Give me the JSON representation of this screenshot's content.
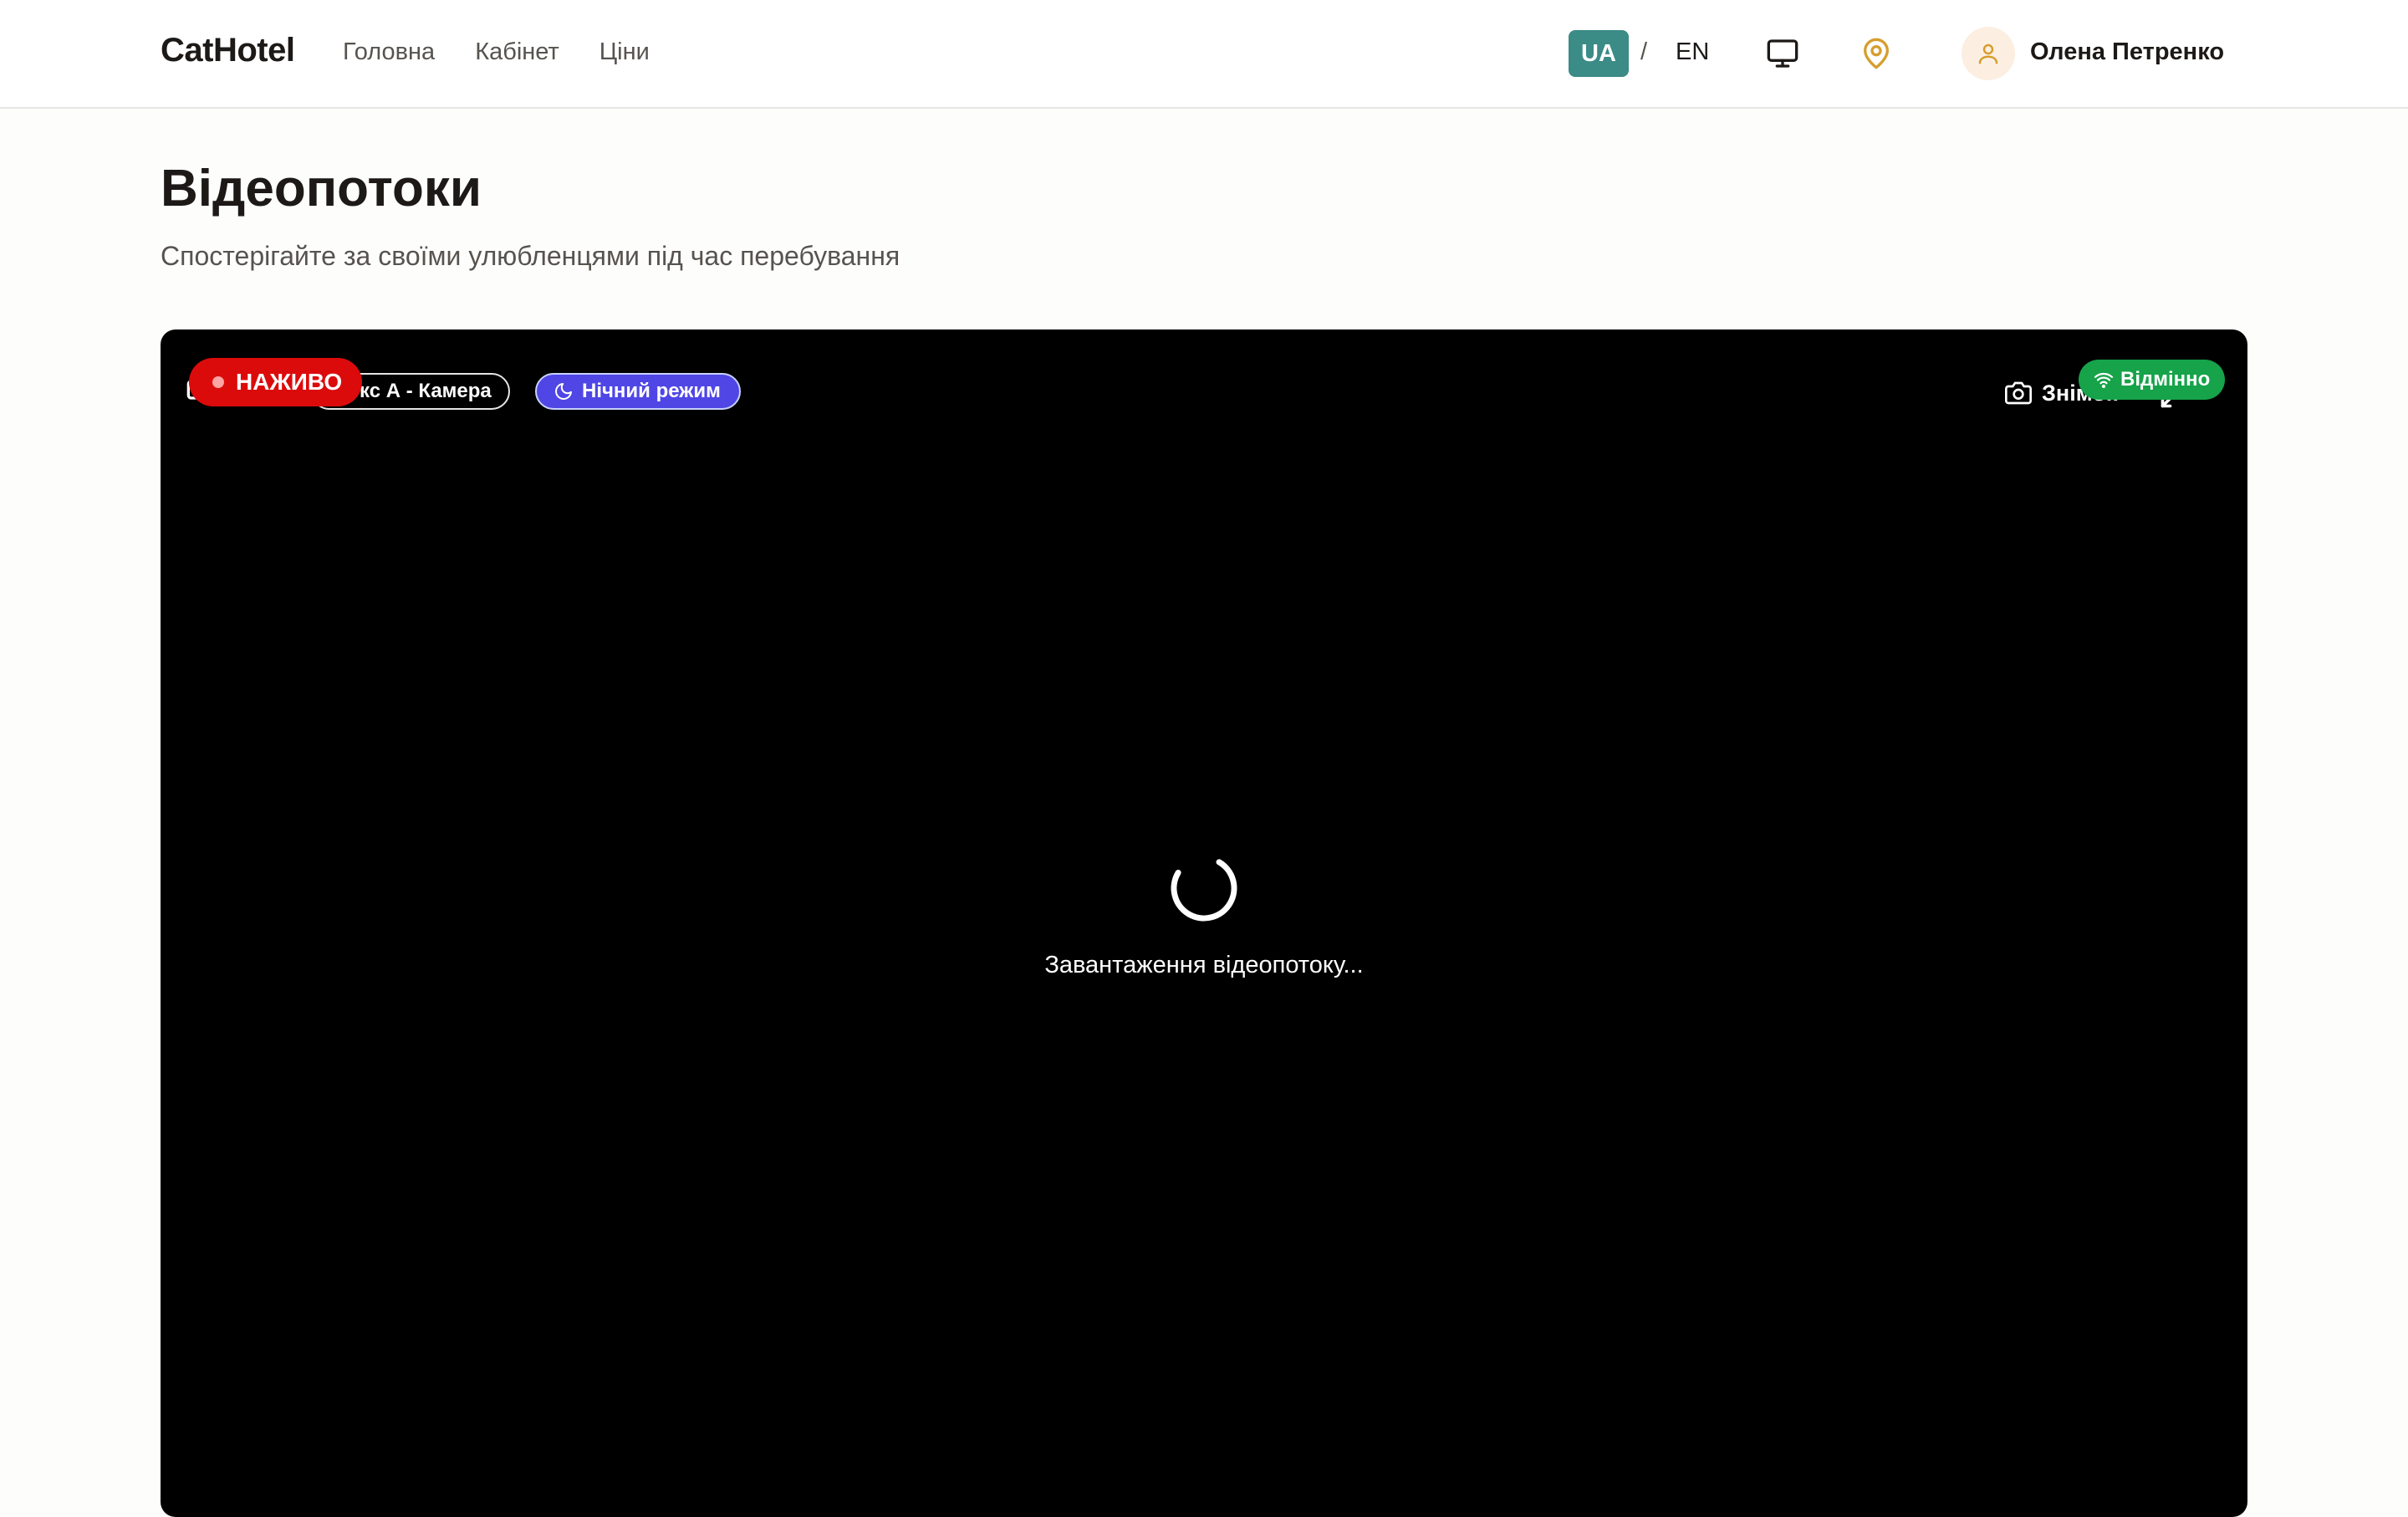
{
  "header": {
    "logo": "CatHotel",
    "nav": [
      {
        "label": "Головна"
      },
      {
        "label": "Кабінет"
      },
      {
        "label": "Ціни"
      }
    ],
    "lang_active": "UA",
    "lang_separator": "/",
    "lang_other": "EN",
    "icons": [
      "monitor-icon",
      "map-pin-icon",
      "user-icon"
    ],
    "user_name": "Олена Петренко"
  },
  "page": {
    "title": "Відеопотоки",
    "subtitle": "Спостерігайте за своїми улюбленцями під час перебування"
  },
  "player": {
    "live_label": "НАЖИВО",
    "camera_label": "кс А - Камера",
    "night_mode_label": "Нічний режим",
    "snapshot_label": "Знімок",
    "quality_label": "Відмінно",
    "loading_text": "Завантаження відеопотоку...",
    "icons": [
      "camera-icon",
      "moon-icon",
      "wifi-icon",
      "fullscreen-icon",
      "loader-spinner"
    ]
  },
  "colors": {
    "accent": "#3b8b86",
    "live": "#dc0b0b",
    "night": "#4f46e5",
    "quality": "#16a34a",
    "pin": "#d69e2e"
  }
}
